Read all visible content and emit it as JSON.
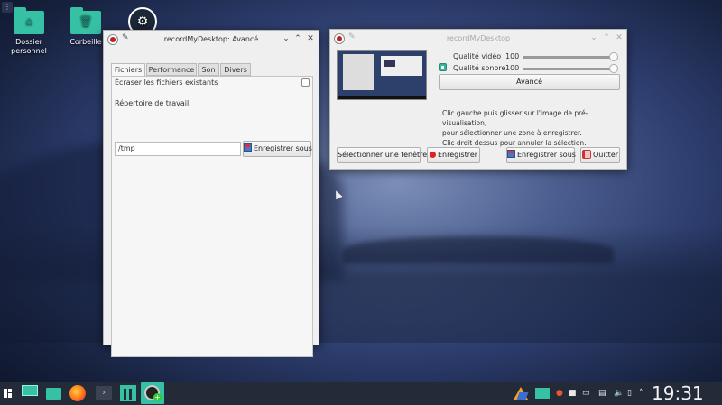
{
  "desktop": {
    "icons": [
      {
        "label": "Dossier personnel",
        "icon": "home-folder-icon"
      },
      {
        "label": "Corbeille",
        "icon": "trash-folder-icon"
      },
      {
        "label": "",
        "icon": "steam-icon"
      }
    ]
  },
  "adv_window": {
    "title": "recordMyDesktop: Avancé",
    "tabs": [
      "Fichiers",
      "Performance",
      "Son",
      "Divers"
    ],
    "active_tab": "Fichiers",
    "overwrite_label": "Écraser les fichiers existants",
    "overwrite_checked": false,
    "workdir_label": "Répertoire de travail",
    "workdir_value": "/tmp",
    "save_as_label": "Enregistrer sous"
  },
  "main_window": {
    "title": "recordMyDesktop",
    "video_quality_label": "Qualité vidéo",
    "video_quality_value": "100",
    "sound_quality_label": "Qualité sonore",
    "sound_quality_value": "100",
    "sound_enabled": true,
    "advanced_button": "Avancé",
    "info_lines": [
      "Clic gauche puis glisser sur l'image de pré-visualisation,",
      "pour sélectionner une zone à enregistrer.",
      "Clic droit dessus pour annuler la sélection."
    ],
    "select_window_button": "Sélectionner une fenêtre",
    "record_button": "Enregistrer",
    "save_as_button": "Enregistrer sous",
    "quit_button": "Quitter"
  },
  "taskbar": {
    "clock": "19:31",
    "accent_color": "#36c0a4"
  }
}
